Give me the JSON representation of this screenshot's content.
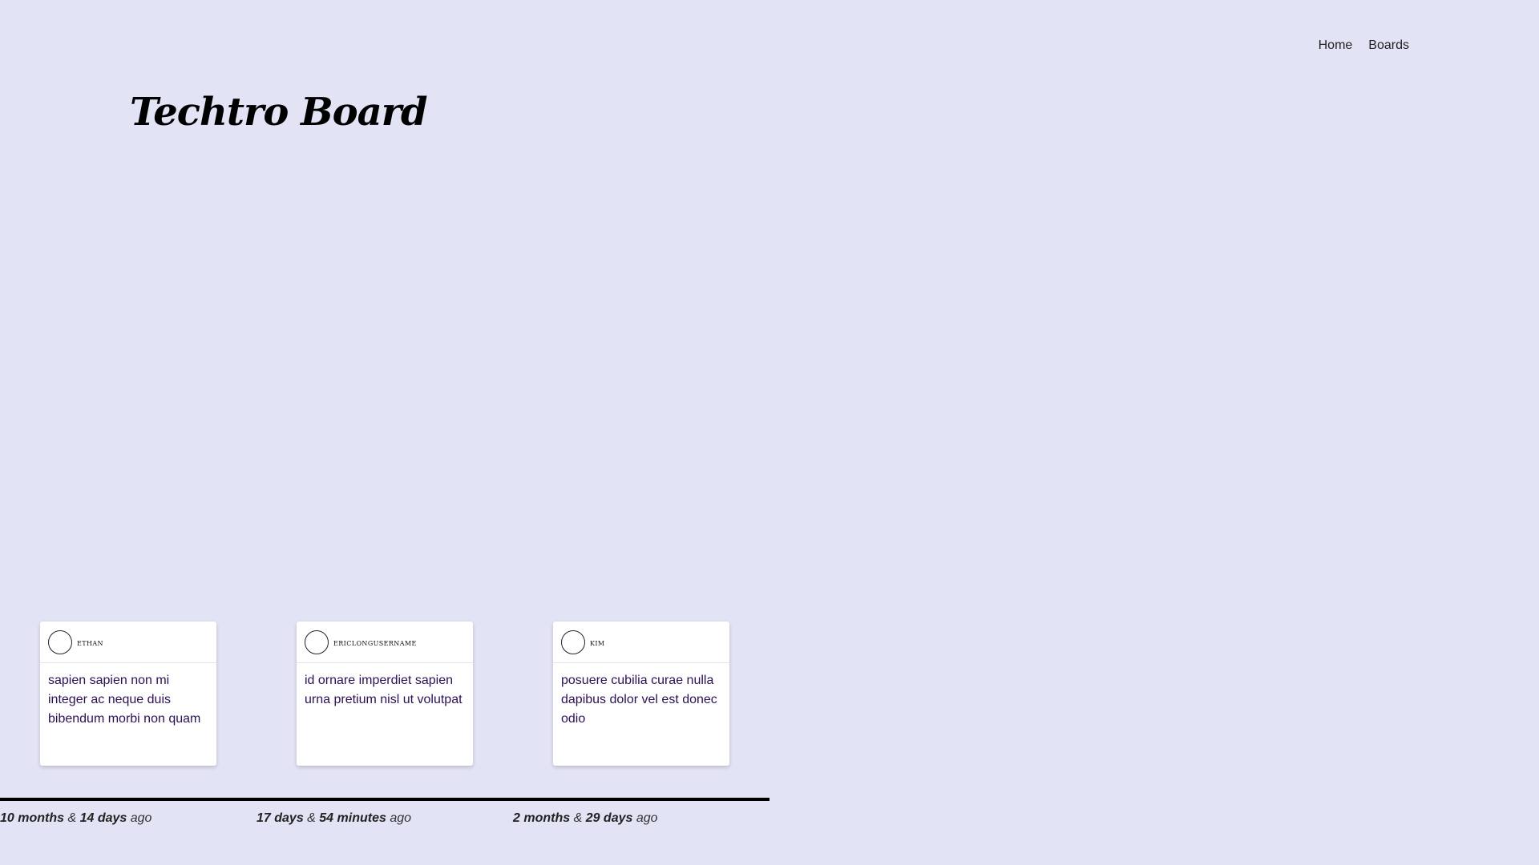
{
  "nav": {
    "home_label": "Home",
    "boards_label": "Boards"
  },
  "logo": {
    "text": "Techtro Board"
  },
  "posts": [
    {
      "username": "ETHAN",
      "text": "sapien sapien non mi integer ac neque duis bibendum morbi non quam",
      "time_first": "10 months",
      "time_sep": " & ",
      "time_second": "14 days",
      "time_suffix": " ago"
    },
    {
      "username": "ERICLONGUSERNAME",
      "text": "id ornare imperdiet sapien urna pretium nisl ut volutpat",
      "time_first": "17 days",
      "time_sep": " & ",
      "time_second": "54 minutes",
      "time_suffix": " ago"
    },
    {
      "username": "KIM",
      "text": "posuere cubilia curae nulla dapibus dolor vel est donec odio",
      "time_first": "2 months",
      "time_sep": " & ",
      "time_second": "29 days",
      "time_suffix": " ago"
    }
  ],
  "colors": {
    "background": "#e2e3f4",
    "post_text": "#2c1054",
    "timeline": "#000000"
  }
}
